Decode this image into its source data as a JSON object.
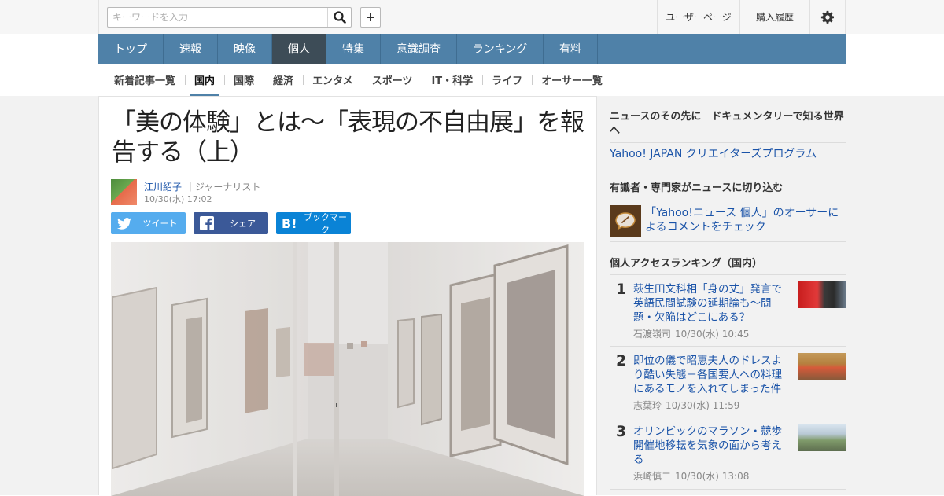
{
  "header": {
    "search_placeholder": "キーワードを入力",
    "user_page": "ユーザーページ",
    "purchase_history": "購入履歴"
  },
  "main_nav": [
    "トップ",
    "速報",
    "映像",
    "個人",
    "特集",
    "意識調査",
    "ランキング",
    "有料"
  ],
  "main_nav_active": "個人",
  "sub_nav": [
    "新着記事一覧",
    "国内",
    "国際",
    "経済",
    "エンタメ",
    "スポーツ",
    "IT・科学",
    "ライフ",
    "オーサー一覧"
  ],
  "sub_nav_active": "国内",
  "article": {
    "title": "「美の体験」とは～「表現の不自由展」を報告する（上）",
    "author_name": "江川紹子",
    "author_role": "｜ジャーナリスト",
    "date": "10/30(水) 17:02",
    "share": {
      "tweet": "ツイート",
      "share": "シェア",
      "bookmark": "ブックマーク"
    }
  },
  "sidebar": {
    "promo_heading": "ニュースのその先に　ドキュメンタリーで知る世界へ",
    "promo_link": "Yahoo! JAPAN クリエイターズプログラム",
    "experts_heading": "有識者・専門家がニュースに切り込む",
    "experts_link": "「Yahoo!ニュース 個人」のオーサーによるコメントをチェック",
    "ranking_heading": "個人アクセスランキング（国内）",
    "ranking": [
      {
        "rank": "1",
        "title": "萩生田文科相「身の丈」発言で英語民間試験の延期論も～問題・欠陥はどこにある？",
        "author": "石渡嶺司",
        "date": "10/30(水) 10:45"
      },
      {
        "rank": "2",
        "title": "即位の儀で昭恵夫人のドレスより酷い失態－各国要人への料理にあるモノを入れてしまった件",
        "author": "志葉玲",
        "date": "10/30(水) 11:59"
      },
      {
        "rank": "3",
        "title": "オリンピックのマラソン・競歩　開催地移転を気象の面から考える",
        "author": "浜崎慎二",
        "date": "10/30(水) 13:08"
      }
    ]
  },
  "colors": {
    "nav_blue": "#4f81a8",
    "nav_active": "#3d4c57",
    "link_blue": "#1a53a8",
    "twitter": "#55acee",
    "facebook": "#3b5998",
    "hatena": "#0a83d6"
  }
}
